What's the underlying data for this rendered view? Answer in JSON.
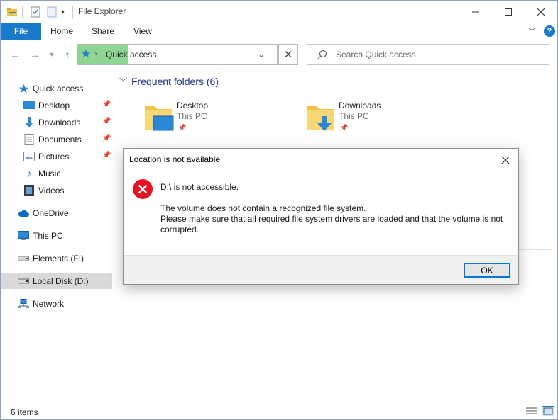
{
  "window": {
    "title": "File Explorer"
  },
  "ribbon": {
    "tabs": [
      {
        "label": "File"
      },
      {
        "label": "Home"
      },
      {
        "label": "Share"
      },
      {
        "label": "View"
      }
    ]
  },
  "address": {
    "path": "Quick access",
    "search_placeholder": "Search Quick access"
  },
  "sidebar": {
    "items": [
      {
        "label": "Quick access",
        "icon": "star-icon"
      },
      {
        "label": "Desktop",
        "icon": "desktop-icon",
        "pinned": true
      },
      {
        "label": "Downloads",
        "icon": "download-icon",
        "pinned": true
      },
      {
        "label": "Documents",
        "icon": "document-icon",
        "pinned": true
      },
      {
        "label": "Pictures",
        "icon": "picture-icon",
        "pinned": true
      },
      {
        "label": "Music",
        "icon": "music-icon"
      },
      {
        "label": "Videos",
        "icon": "video-icon"
      },
      {
        "label": "OneDrive",
        "icon": "cloud-icon"
      },
      {
        "label": "This PC",
        "icon": "computer-icon"
      },
      {
        "label": "Elements (F:)",
        "icon": "drive-icon"
      },
      {
        "label": "Local Disk (D:)",
        "icon": "drive-icon",
        "selected": true
      },
      {
        "label": "Network",
        "icon": "network-icon"
      }
    ]
  },
  "main": {
    "section_title": "Frequent folders (6)",
    "tiles": [
      {
        "name": "Desktop",
        "location": "This PC"
      },
      {
        "name": "Downloads",
        "location": "This PC"
      }
    ]
  },
  "status": {
    "item_count": "6 items"
  },
  "dialog": {
    "title": "Location is not available",
    "heading": "D:\\ is not accessible.",
    "message_line1": "The volume does not contain a recognized file system.",
    "message_line2": "Please make sure that all required file system drivers are loaded and that the volume is not corrupted.",
    "ok_label": "OK"
  },
  "colors": {
    "accent": "#1979ca",
    "address_highlight": "#8ed593",
    "section_title": "#1e3287",
    "error": "#e81123"
  }
}
